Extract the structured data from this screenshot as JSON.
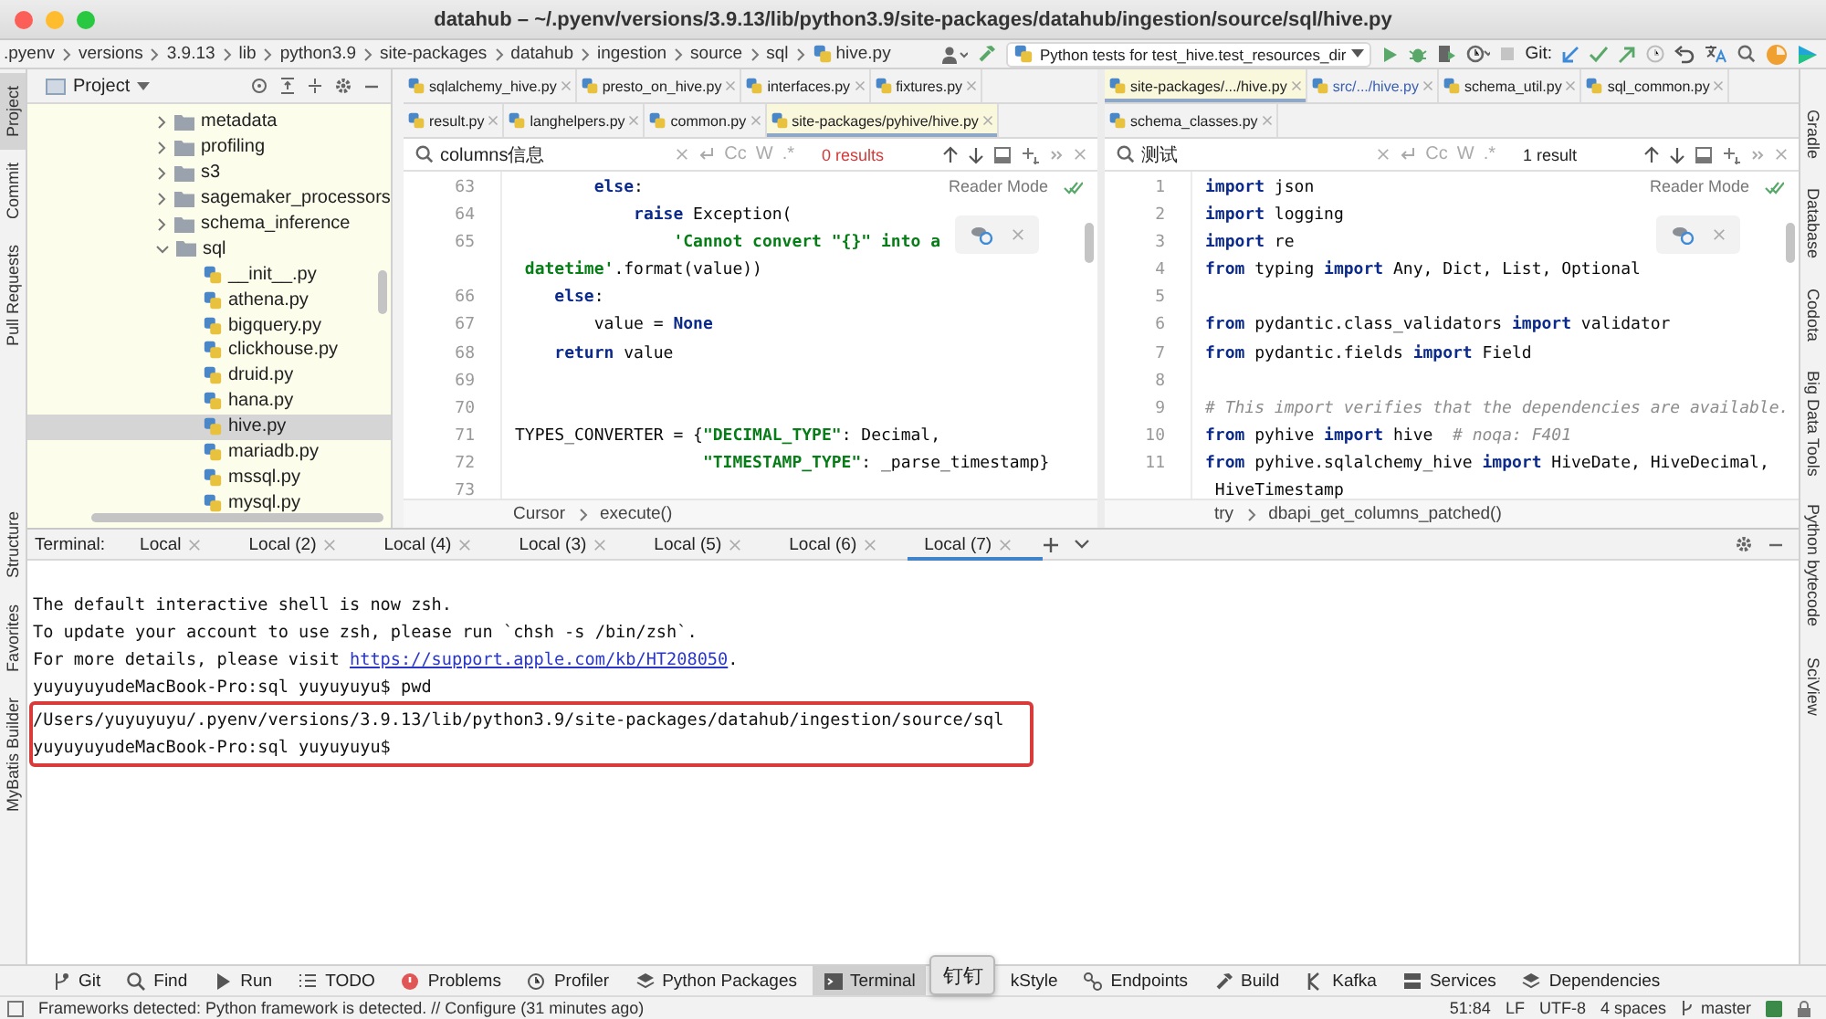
{
  "window": {
    "title": "datahub – ~/.pyenv/versions/3.9.13/lib/python3.9/site-packages/datahub/ingestion/source/sql/hive.py"
  },
  "breadcrumbs": [
    ".pyenv",
    "versions",
    "3.9.13",
    "lib",
    "python3.9",
    "site-packages",
    "datahub",
    "ingestion",
    "source",
    "sql",
    "hive.py"
  ],
  "toolbar": {
    "run_config": "Python tests for test_hive.test_resources_dir",
    "git_label": "Git:"
  },
  "left_strip": {
    "top": [
      {
        "label": "Project",
        "selected": true
      },
      {
        "label": "Commit",
        "selected": false
      },
      {
        "label": "Pull Requests",
        "selected": false
      }
    ],
    "bottom": [
      {
        "label": "Structure",
        "selected": false
      },
      {
        "label": "Favorites",
        "selected": false
      },
      {
        "label": "MyBatis Builder",
        "selected": false
      }
    ]
  },
  "right_strip": [
    {
      "label": "Gradle",
      "selected": false
    },
    {
      "label": "Database",
      "selected": false
    },
    {
      "label": "Codota",
      "selected": false
    },
    {
      "label": "Big Data Tools",
      "selected": false
    },
    {
      "label": "Python bytecode",
      "selected": false
    },
    {
      "label": "SciView",
      "selected": false
    }
  ],
  "project": {
    "title": "Project",
    "tree": [
      {
        "label": "metadata",
        "kind": "folder",
        "expanded": false,
        "selected": false
      },
      {
        "label": "profiling",
        "kind": "folder",
        "expanded": false,
        "selected": false
      },
      {
        "label": "s3",
        "kind": "folder",
        "expanded": false,
        "selected": false
      },
      {
        "label": "sagemaker_processors",
        "kind": "folder",
        "expanded": false,
        "selected": false
      },
      {
        "label": "schema_inference",
        "kind": "folder",
        "expanded": false,
        "selected": false
      },
      {
        "label": "sql",
        "kind": "folder",
        "expanded": true,
        "selected": false,
        "children": [
          {
            "label": "__init__.py",
            "kind": "file",
            "selected": false
          },
          {
            "label": "athena.py",
            "kind": "file",
            "selected": false
          },
          {
            "label": "bigquery.py",
            "kind": "file",
            "selected": false
          },
          {
            "label": "clickhouse.py",
            "kind": "file",
            "selected": false
          },
          {
            "label": "druid.py",
            "kind": "file",
            "selected": false
          },
          {
            "label": "hana.py",
            "kind": "file",
            "selected": false
          },
          {
            "label": "hive.py",
            "kind": "file",
            "selected": true
          },
          {
            "label": "mariadb.py",
            "kind": "file",
            "selected": false
          },
          {
            "label": "mssql.py",
            "kind": "file",
            "selected": false
          },
          {
            "label": "mysql.py",
            "kind": "file",
            "selected": false
          }
        ]
      }
    ]
  },
  "editors": [
    {
      "tab_rows": [
        [
          {
            "label": "sqlalchemy_hive.py",
            "selected": false,
            "library": false,
            "modified": false
          },
          {
            "label": "presto_on_hive.py",
            "selected": false,
            "library": false,
            "modified": false
          },
          {
            "label": "interfaces.py",
            "selected": false,
            "library": false,
            "modified": false
          },
          {
            "label": "fixtures.py",
            "selected": false,
            "library": false,
            "modified": false
          }
        ],
        [
          {
            "label": "result.py",
            "selected": false,
            "library": false,
            "modified": false
          },
          {
            "label": "langhelpers.py",
            "selected": false,
            "library": false,
            "modified": false
          },
          {
            "label": "common.py",
            "selected": false,
            "library": false,
            "modified": false
          },
          {
            "label": "site-packages/pyhive/hive.py",
            "selected": true,
            "library": true,
            "modified": false
          }
        ]
      ],
      "search": {
        "value": "columns信息",
        "options": [
          "Cc",
          "W",
          ".*"
        ],
        "results": "0 results",
        "found": false
      },
      "reader_mode": "Reader Mode",
      "lines": [
        {
          "num": "63",
          "segs": [
            {
              "kind": "keyword",
              "text": "        else"
            },
            {
              "kind": "plain",
              "text": ":"
            }
          ]
        },
        {
          "num": "64",
          "segs": [
            {
              "kind": "keyword",
              "text": "            raise"
            },
            {
              "kind": "plain",
              "text": " Exception("
            }
          ]
        },
        {
          "num": "65",
          "segs": [
            {
              "kind": "string",
              "text": "                'Cannot convert \"{}\" into a"
            }
          ]
        },
        {
          "segs": [
            {
              "kind": "string",
              "text": " datetime'"
            },
            {
              "kind": "plain",
              "text": ".format(value))"
            }
          ]
        },
        {
          "num": "66",
          "segs": [
            {
              "kind": "keyword",
              "text": "    else"
            },
            {
              "kind": "plain",
              "text": ":"
            }
          ]
        },
        {
          "num": "67",
          "segs": [
            {
              "kind": "plain",
              "text": "        value = "
            },
            {
              "kind": "keyword",
              "text": "None"
            }
          ]
        },
        {
          "num": "68",
          "segs": [
            {
              "kind": "keyword",
              "text": "    return"
            },
            {
              "kind": "plain",
              "text": " value"
            }
          ]
        },
        {
          "num": "69"
        },
        {
          "num": "70"
        },
        {
          "num": "71",
          "segs": [
            {
              "kind": "plain",
              "text": "TYPES_CONVERTER = {"
            },
            {
              "kind": "string",
              "text": "\"DECIMAL_TYPE\""
            },
            {
              "kind": "plain",
              "text": ": Decimal,"
            }
          ]
        },
        {
          "num": "72",
          "segs": [
            {
              "kind": "string",
              "text": "                   \"TIMESTAMP_TYPE\""
            },
            {
              "kind": "plain",
              "text": ": _parse_timestamp}"
            }
          ]
        },
        {
          "num": "73"
        }
      ],
      "breadcrumb": [
        "Cursor",
        "execute()"
      ]
    },
    {
      "tab_rows": [
        [
          {
            "label": "site-packages/.../hive.py",
            "selected": true,
            "library": true,
            "modified": false
          },
          {
            "label": "src/.../hive.py",
            "selected": false,
            "library": false,
            "modified": true
          },
          {
            "label": "schema_util.py",
            "selected": false,
            "library": false,
            "modified": false
          },
          {
            "label": "sql_common.py",
            "selected": false,
            "library": false,
            "modified": false
          }
        ],
        [
          {
            "label": "schema_classes.py",
            "selected": false,
            "library": false,
            "modified": false
          }
        ]
      ],
      "search": {
        "value": "测试",
        "options": [
          "Cc",
          "W",
          ".*"
        ],
        "results": "1 result",
        "found": true
      },
      "reader_mode": "Reader Mode",
      "lines": [
        {
          "num": "1",
          "segs": [
            {
              "kind": "keyword",
              "text": "import"
            },
            {
              "kind": "plain",
              "text": " json"
            }
          ]
        },
        {
          "num": "2",
          "segs": [
            {
              "kind": "keyword",
              "text": "import"
            },
            {
              "kind": "plain",
              "text": " logging"
            }
          ]
        },
        {
          "num": "3",
          "segs": [
            {
              "kind": "keyword",
              "text": "import"
            },
            {
              "kind": "plain",
              "text": " re"
            }
          ]
        },
        {
          "num": "4",
          "segs": [
            {
              "kind": "keyword",
              "text": "from"
            },
            {
              "kind": "plain",
              "text": " typing "
            },
            {
              "kind": "keyword",
              "text": "import"
            },
            {
              "kind": "plain",
              "text": " Any, Dict, List, Optional"
            }
          ]
        },
        {
          "num": "5"
        },
        {
          "num": "6",
          "segs": [
            {
              "kind": "keyword",
              "text": "from"
            },
            {
              "kind": "plain",
              "text": " pydantic.class_validators "
            },
            {
              "kind": "keyword",
              "text": "import"
            },
            {
              "kind": "plain",
              "text": " validator"
            }
          ]
        },
        {
          "num": "7",
          "segs": [
            {
              "kind": "keyword",
              "text": "from"
            },
            {
              "kind": "plain",
              "text": " pydantic.fields "
            },
            {
              "kind": "keyword",
              "text": "import"
            },
            {
              "kind": "plain",
              "text": " Field"
            }
          ]
        },
        {
          "num": "8"
        },
        {
          "num": "9",
          "segs": [
            {
              "kind": "comment",
              "text": "# This import verifies that the dependencies are available."
            }
          ]
        },
        {
          "num": "10",
          "segs": [
            {
              "kind": "keyword",
              "text": "from"
            },
            {
              "kind": "plain",
              "text": " pyhive "
            },
            {
              "kind": "keyword",
              "text": "import"
            },
            {
              "kind": "plain",
              "text": " hive  "
            },
            {
              "kind": "comment",
              "text": "# noqa: F401"
            }
          ]
        },
        {
          "num": "11",
          "segs": [
            {
              "kind": "keyword",
              "text": "from"
            },
            {
              "kind": "plain",
              "text": " pyhive.sqlalchemy_hive "
            },
            {
              "kind": "keyword",
              "text": "import"
            },
            {
              "kind": "plain",
              "text": " HiveDate, HiveDecimal,"
            }
          ]
        },
        {
          "segs": [
            {
              "kind": "plain",
              "text": " HiveTimestamp"
            }
          ]
        }
      ],
      "breadcrumb": [
        "try",
        "dbapi_get_columns_patched()"
      ]
    }
  ],
  "terminal": {
    "label": "Terminal:",
    "tabs": [
      {
        "label": "Local",
        "selected": false
      },
      {
        "label": "Local (2)",
        "selected": false
      },
      {
        "label": "Local (4)",
        "selected": false
      },
      {
        "label": "Local (3)",
        "selected": false
      },
      {
        "label": "Local (5)",
        "selected": false
      },
      {
        "label": "Local (6)",
        "selected": false
      },
      {
        "label": "Local (7)",
        "selected": true
      }
    ],
    "lines": [
      {
        "text": "The default interactive shell is now zsh.",
        "highlighted": false
      },
      {
        "text": "To update your account to use zsh, please run `chsh -s /bin/zsh`.",
        "highlighted": false
      },
      {
        "text": "For more details, please visit ",
        "link": "https://support.apple.com/kb/HT208050",
        "tail": ".",
        "highlighted": false
      },
      {
        "text": "yuyuyuyudeMacBook-Pro:sql yuyuyuyu$ pwd",
        "highlighted": false
      },
      {
        "text": "/Users/yuyuyuyu/.pyenv/versions/3.9.13/lib/python3.9/site-packages/datahub/ingestion/source/sql",
        "highlighted": true
      },
      {
        "text": "yuyuyuyudeMacBook-Pro:sql yuyuyuyu$",
        "highlighted": true
      }
    ]
  },
  "tool_windows": [
    {
      "label": "Git",
      "selected": false
    },
    {
      "label": "Find",
      "selected": false
    },
    {
      "label": "Run",
      "selected": false
    },
    {
      "label": "TODO",
      "selected": false
    },
    {
      "label": "Problems",
      "selected": false
    },
    {
      "label": "Profiler",
      "selected": false
    },
    {
      "label": "Python Packages",
      "selected": false
    },
    {
      "label": "Terminal",
      "selected": true
    },
    {
      "label": "kStyle",
      "selected": false
    },
    {
      "label": "Endpoints",
      "selected": false
    },
    {
      "label": "Build",
      "selected": false
    },
    {
      "label": "Kafka",
      "selected": false
    },
    {
      "label": "Services",
      "selected": false
    },
    {
      "label": "Dependencies",
      "selected": false
    }
  ],
  "tooltip": "钉钉",
  "status": {
    "message": "Frameworks detected: Python framework is detected. // Configure (31 minutes ago)",
    "items": [
      "51:84",
      "LF",
      "UTF-8",
      "4 spaces",
      "master"
    ]
  }
}
